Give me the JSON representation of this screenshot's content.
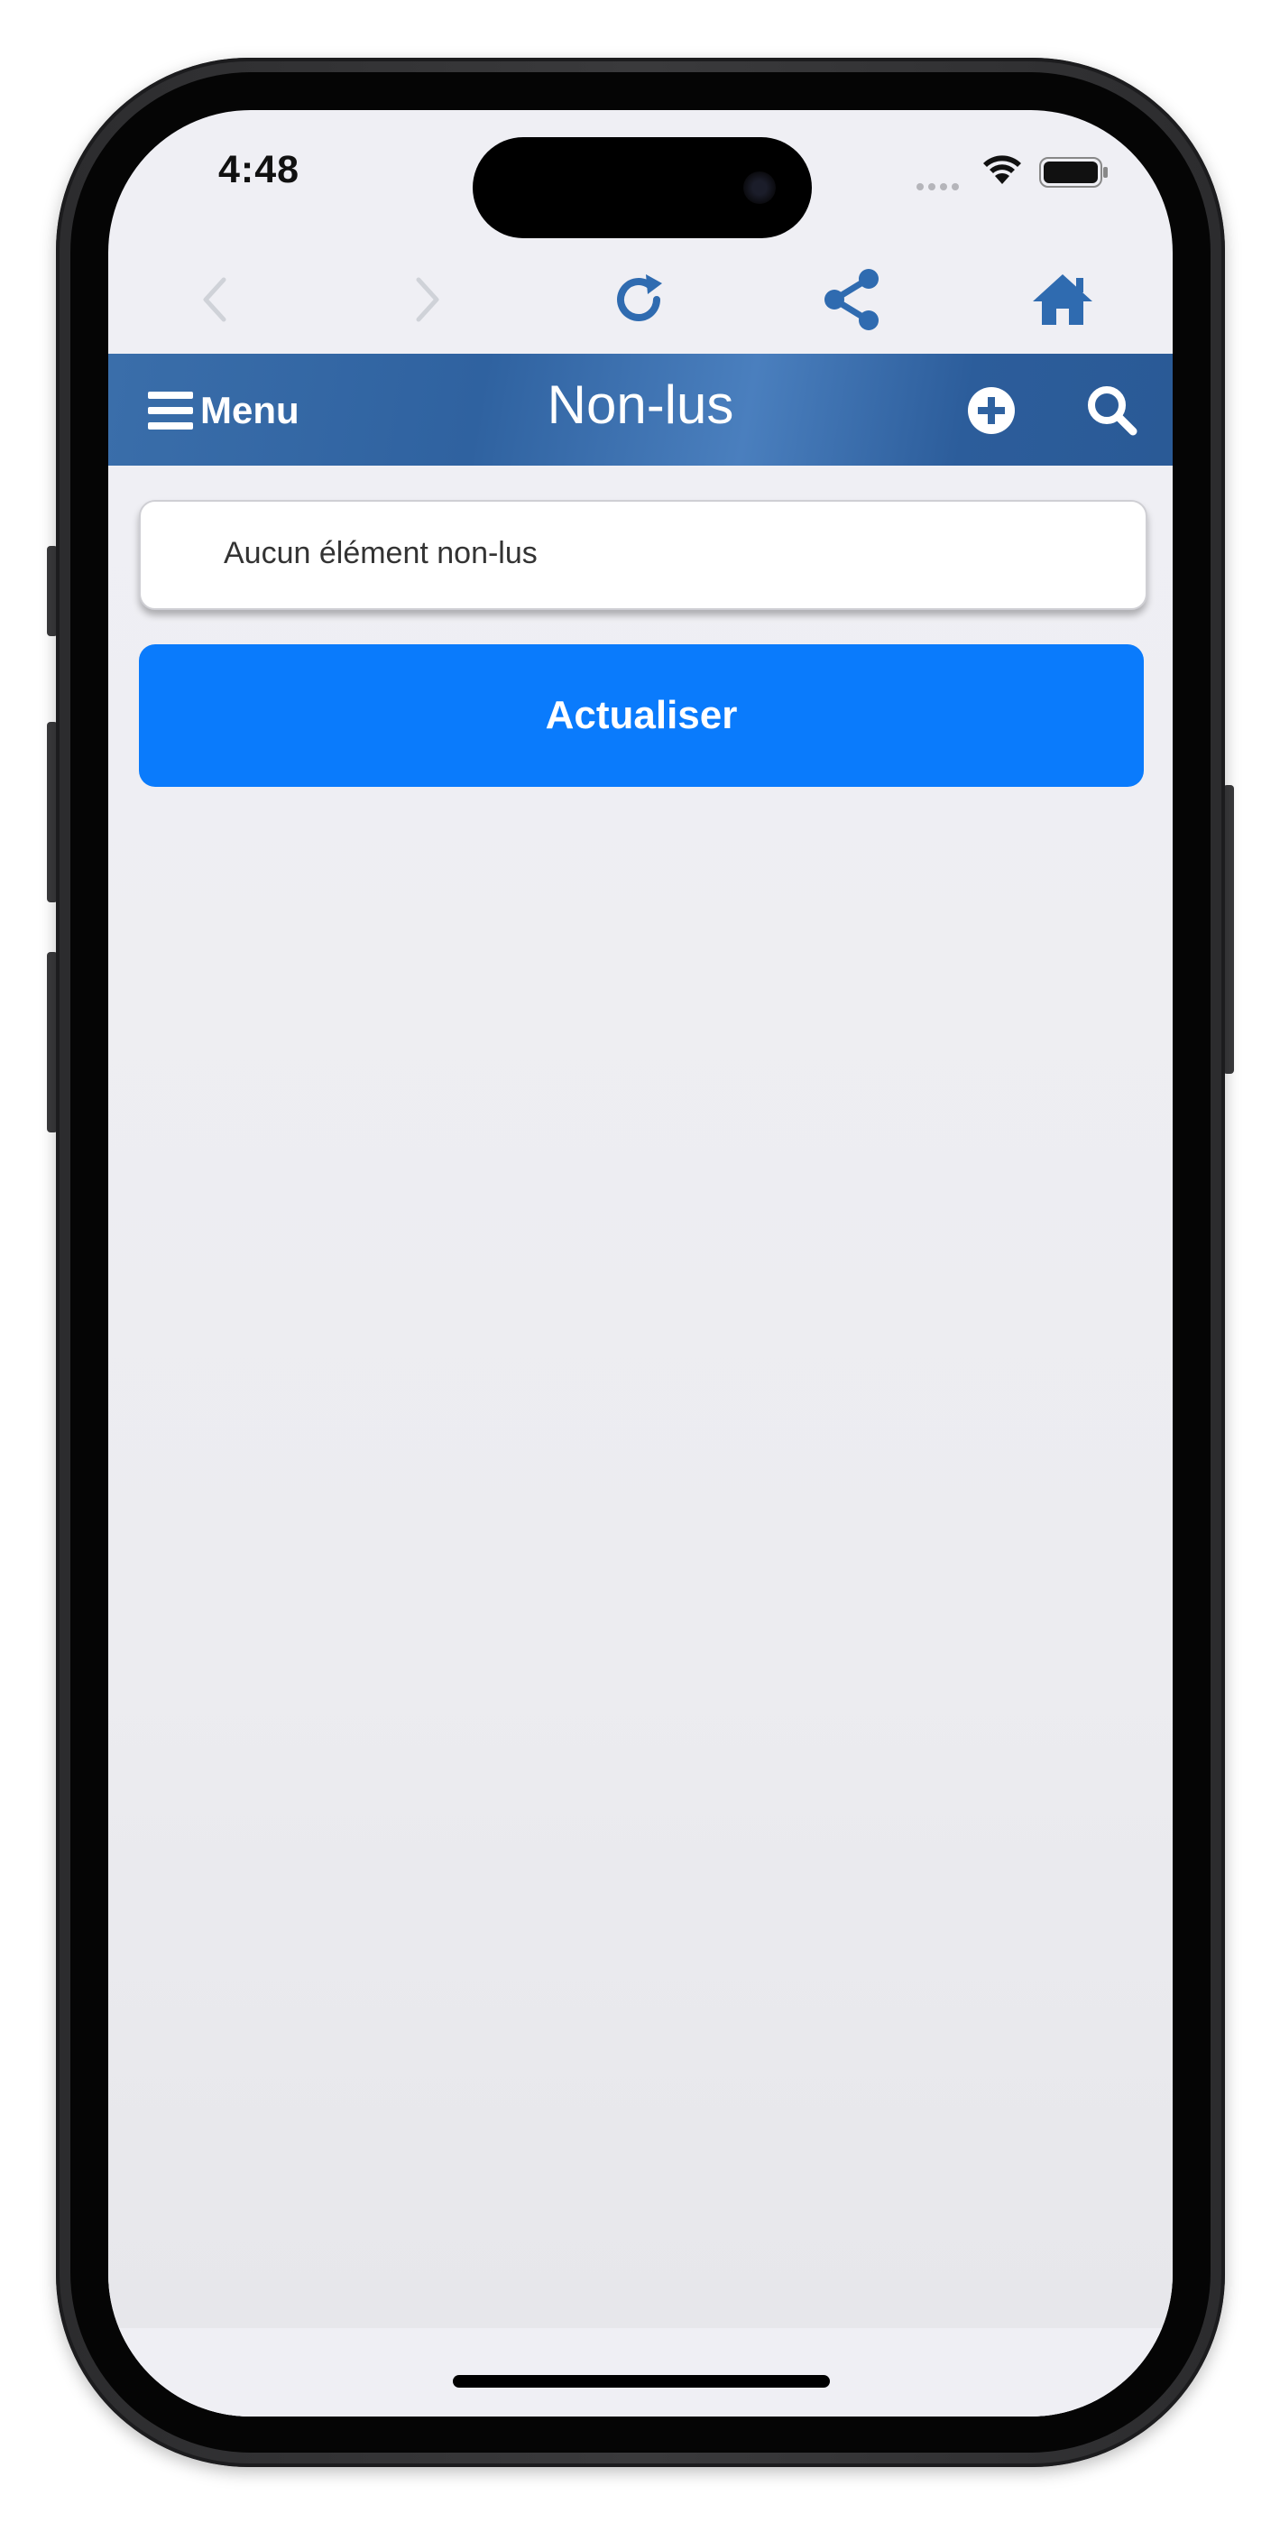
{
  "status_bar": {
    "time": "4:48"
  },
  "browser_toolbar": {
    "icons": [
      "chevron-left-icon",
      "chevron-right-icon",
      "reload-icon",
      "share-icon",
      "home-icon"
    ]
  },
  "header": {
    "menu_label": "Menu",
    "title": "Non-lus",
    "icons": [
      "hamburger-icon",
      "plus-circle-icon",
      "search-icon"
    ]
  },
  "content": {
    "empty_message": "Aucun élément non-lus",
    "refresh_label": "Actualiser"
  },
  "colors": {
    "header_blue": "#2f62a0",
    "button_blue": "#0a7bfc",
    "toolbar_icon_blue": "#2f6bb0",
    "background": "#efeff4"
  }
}
